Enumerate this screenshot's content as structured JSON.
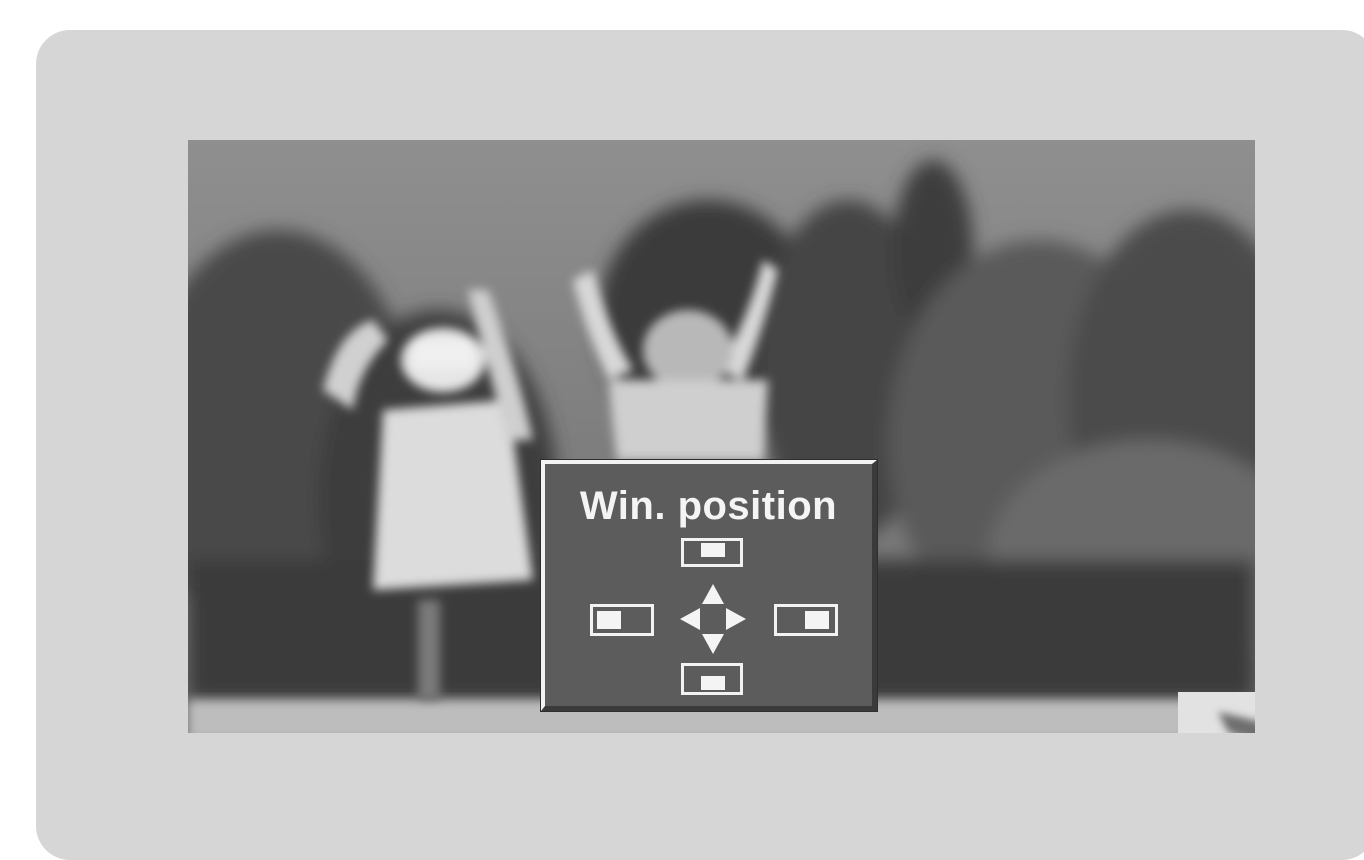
{
  "osd": {
    "title": "Win. position",
    "icons": [
      "position-up-icon",
      "position-left-icon",
      "direction-arrows-icon",
      "position-right-icon",
      "position-down-icon"
    ]
  },
  "colors": {
    "bezel": "#d6d6d6",
    "osd_background": "#5c5c5c",
    "osd_text": "#f4f4f4"
  }
}
